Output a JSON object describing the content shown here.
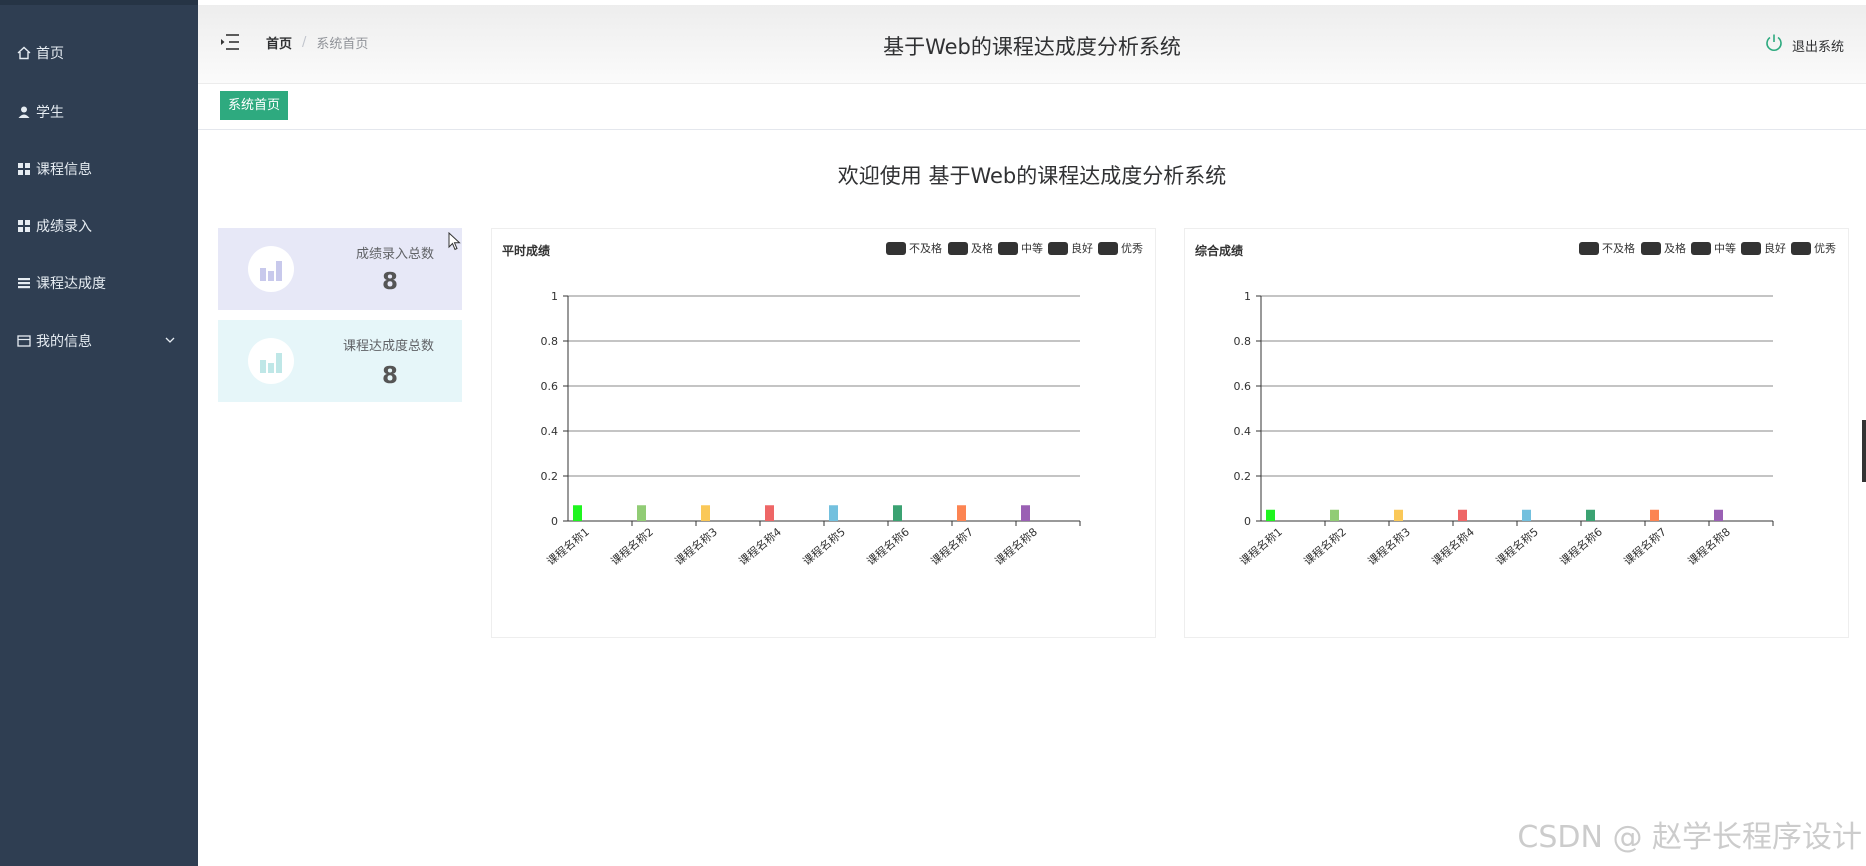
{
  "sidebar": {
    "items": [
      {
        "label": "首页",
        "icon": "home-icon"
      },
      {
        "label": "学生",
        "icon": "user-icon"
      },
      {
        "label": "课程信息",
        "icon": "grid-icon"
      },
      {
        "label": "成绩录入",
        "icon": "grid-icon"
      },
      {
        "label": "课程达成度",
        "icon": "list-icon"
      },
      {
        "label": "我的信息",
        "icon": "card-icon"
      }
    ]
  },
  "header": {
    "breadcrumb_home": "首页",
    "breadcrumb_sep": "/",
    "breadcrumb_current": "系统首页",
    "title": "基于Web的课程达成度分析系统",
    "logout_label": "退出系统"
  },
  "tags": {
    "active": "系统首页"
  },
  "welcome": "欢迎使用 基于Web的课程达成度分析系统",
  "stats": [
    {
      "label": "成绩录入总数",
      "value": "8"
    },
    {
      "label": "课程达成度总数",
      "value": "8"
    }
  ],
  "colors": {
    "sidebar_bg": "#2f3e52",
    "accent": "#2eaa7f",
    "bar_colors": [
      "#1ff51f",
      "#91cc75",
      "#fac858",
      "#ee6666",
      "#73c0de",
      "#3ba272",
      "#fc8452",
      "#9a60b4"
    ]
  },
  "watermark": "CSDN @ 赵学长程序设计",
  "chart_data": [
    {
      "type": "bar",
      "title": "平时成绩",
      "legend": [
        "不及格",
        "及格",
        "中等",
        "良好",
        "优秀"
      ],
      "legend_position": "top-right",
      "categories": [
        "课程名称1",
        "课程名称2",
        "课程名称3",
        "课程名称4",
        "课程名称5",
        "课程名称6",
        "课程名称7",
        "课程名称8"
      ],
      "values": [
        0.07,
        0.07,
        0.07,
        0.07,
        0.07,
        0.07,
        0.07,
        0.07
      ],
      "ylim": [
        0,
        1
      ],
      "yticks": [
        "0",
        "0.2",
        "0.4",
        "0.6",
        "0.8",
        "1"
      ],
      "grid": true
    },
    {
      "type": "bar",
      "title": "综合成绩",
      "legend": [
        "不及格",
        "及格",
        "中等",
        "良好",
        "优秀"
      ],
      "legend_position": "top-right",
      "categories": [
        "课程名称1",
        "课程名称2",
        "课程名称3",
        "课程名称4",
        "课程名称5",
        "课程名称6",
        "课程名称7",
        "课程名称8"
      ],
      "values": [
        0.05,
        0.05,
        0.05,
        0.05,
        0.05,
        0.05,
        0.05,
        0.05
      ],
      "ylim": [
        0,
        1
      ],
      "yticks": [
        "0",
        "0.2",
        "0.4",
        "0.6",
        "0.8",
        "1"
      ],
      "grid": true
    }
  ]
}
